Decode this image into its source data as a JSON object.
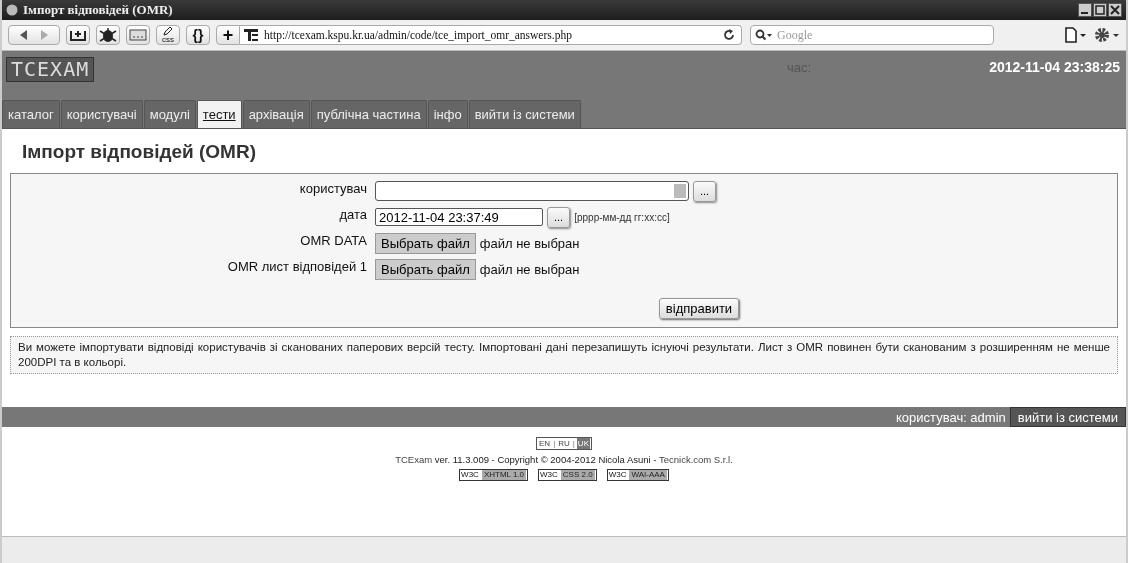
{
  "window": {
    "title": "Імпорт відповідей (OMR)"
  },
  "toolbar": {
    "braces": "{}",
    "css": "css",
    "plus": "+",
    "url": "http://tcexam.kspu.kr.ua/admin/code/tce_import_omr_answers.php",
    "search_placeholder": "Google"
  },
  "header": {
    "logo": "TCEXAM",
    "time_label": "час:",
    "time": "2012-11-04 23:38:25"
  },
  "tabs": [
    {
      "label": "каталог",
      "selected": false
    },
    {
      "label": "користувачі",
      "selected": false
    },
    {
      "label": "модулі",
      "selected": false
    },
    {
      "label": "тести",
      "selected": true
    },
    {
      "label": "архівація",
      "selected": false
    },
    {
      "label": "публічна частина",
      "selected": false
    },
    {
      "label": "інфо",
      "selected": false
    },
    {
      "label": "вийти із системи",
      "selected": false
    }
  ],
  "heading": "Імпорт відповідей (OMR)",
  "form": {
    "fields": [
      {
        "kind": "select",
        "label": "користувач",
        "button": "..."
      },
      {
        "kind": "text",
        "label": "дата",
        "value": "2012-11-04 23:37:49",
        "button": "...",
        "hint": "[рррр-мм-дд гг:хх:сс]"
      },
      {
        "kind": "file",
        "label": "OMR DATA",
        "button": "Выбрать файл",
        "status": "файл не выбран"
      },
      {
        "kind": "file",
        "label": "OMR лист відповідей 1",
        "button": "Выбрать файл",
        "status": "файл не выбран"
      }
    ],
    "submit": "відправити"
  },
  "help": "Ви можете імпортувати відповіді користувачів зі сканованих паперових версій тесту. Імпортовані дані перезапишуть існуючі результати. Лист з OMR повинен бути сканованим з розширенням не менше 200DPI та в кольорі.",
  "footer_bar": {
    "user": "користувач: admin",
    "logout": "вийти із системи"
  },
  "language_separator": "|",
  "languages": [
    {
      "label": "EN",
      "selected": false
    },
    {
      "label": "RU",
      "selected": false
    },
    {
      "label": "UK",
      "selected": true
    }
  ],
  "copyright": {
    "product": "TCExam",
    "text": " ver. 11.3.009 - Copyright © 2004-2012 Nicola Asuni - ",
    "company": "Tecnick.com S.r.l."
  },
  "badges": [
    {
      "prefix": "W3C",
      "label": "XHTML 1.0"
    },
    {
      "prefix": "W3C",
      "label": "CSS 2.0"
    },
    {
      "prefix": "W3C",
      "label": "WAI-AAA"
    }
  ]
}
